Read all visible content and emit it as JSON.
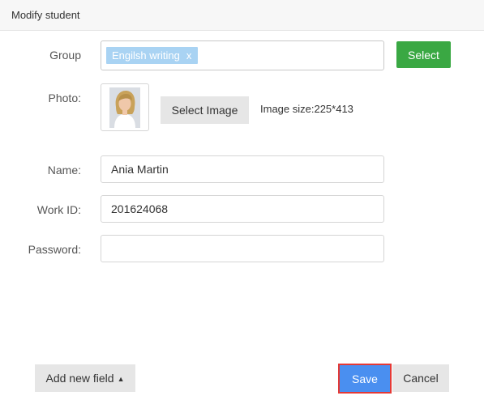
{
  "dialog": {
    "title": "Modify student"
  },
  "form": {
    "group": {
      "label": "Group",
      "tags": [
        {
          "text": "Engilsh writing",
          "remove": "x"
        }
      ],
      "select_label": "Select"
    },
    "photo": {
      "label": "Photo:",
      "select_image_label": "Select Image",
      "size_hint": "Image size:225*413"
    },
    "name": {
      "label": "Name:",
      "value": "Ania Martin"
    },
    "work_id": {
      "label": "Work ID:",
      "value": "201624068"
    },
    "password": {
      "label": "Password:",
      "value": ""
    }
  },
  "footer": {
    "add_field_label": "Add new field",
    "add_field_caret": "▲",
    "save_label": "Save",
    "cancel_label": "Cancel"
  },
  "colors": {
    "select_button": "#3aa843",
    "save_button": "#4a8ff0",
    "save_highlight": "#e53935",
    "tag": "#a9d3f3"
  }
}
